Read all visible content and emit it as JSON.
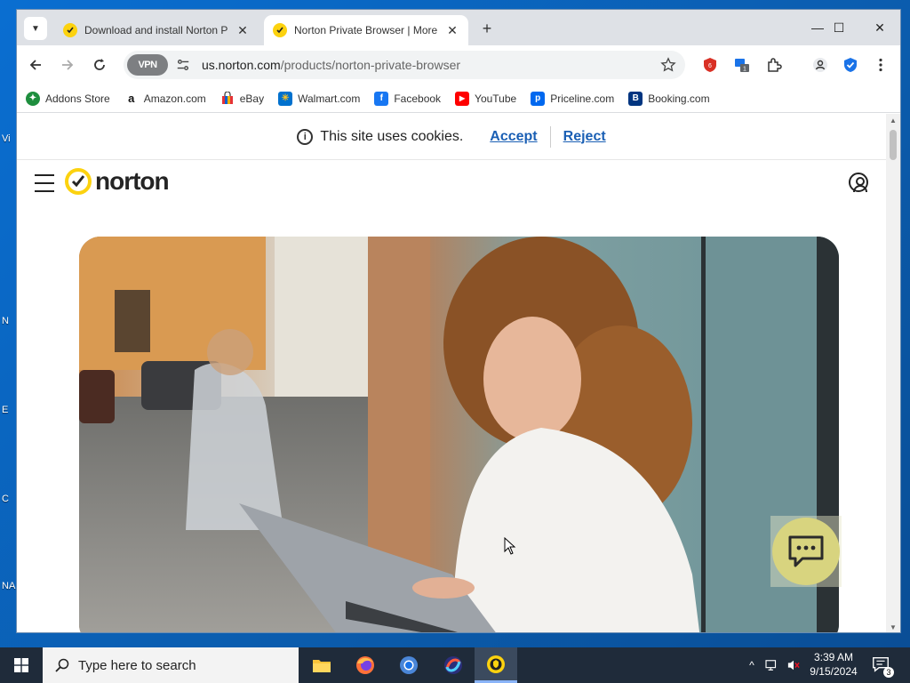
{
  "browser": {
    "tabs": [
      {
        "title": "Download and install Norton P",
        "active": false
      },
      {
        "title": "Norton Private Browser | More",
        "active": true
      }
    ],
    "new_tab_label": "+",
    "window_controls": {
      "minimize": "—",
      "maximize": "☐",
      "close": "✕"
    },
    "vpn_label": "VPN",
    "url_host": "us.norton.com",
    "url_path": "/products/norton-private-browser",
    "extension_badge": "1"
  },
  "bookmarks": [
    {
      "label": "Addons Store",
      "icon": "addons-store-icon",
      "color": "#1e8e3e"
    },
    {
      "label": "Amazon.com",
      "icon": "amazon-icon",
      "color": "#ffffff"
    },
    {
      "label": "eBay",
      "icon": "ebay-icon",
      "color": "#ffffff"
    },
    {
      "label": "Walmart.com",
      "icon": "walmart-icon",
      "color": "#0071ce"
    },
    {
      "label": "Facebook",
      "icon": "facebook-icon",
      "color": "#1877f2"
    },
    {
      "label": "YouTube",
      "icon": "youtube-icon",
      "color": "#ff0000"
    },
    {
      "label": "Priceline.com",
      "icon": "priceline-icon",
      "color": "#0068ef"
    },
    {
      "label": "Booking.com",
      "icon": "booking-icon",
      "color": "#003580"
    }
  ],
  "cookie_banner": {
    "message": "This site uses cookies.",
    "accept": "Accept",
    "reject": "Reject"
  },
  "site": {
    "logo_text": "norton",
    "brand_color": "#fcd20f"
  },
  "taskbar": {
    "search_placeholder": "Type here to search",
    "time": "3:39 AM",
    "date": "9/15/2024",
    "notification_count": "3"
  },
  "desktop_marks": [
    "Vi",
    "N",
    "E",
    "C",
    "NA"
  ]
}
